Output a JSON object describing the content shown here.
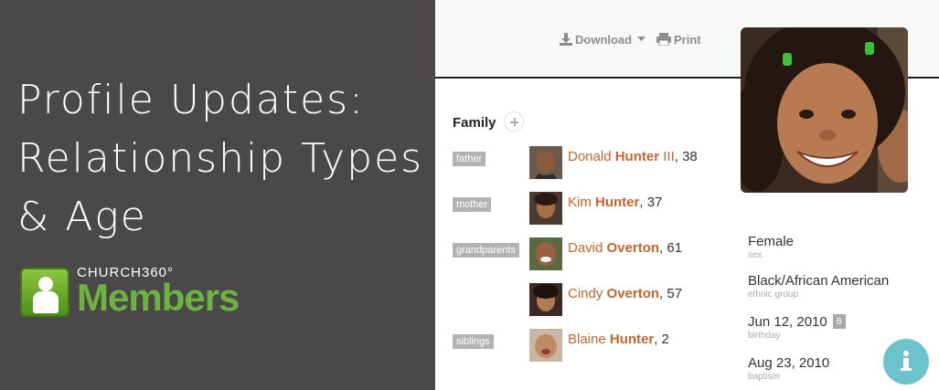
{
  "banner": {
    "headline_lines": [
      "Profile Updates:",
      "Relationship Types",
      "& Age"
    ],
    "logo_small": "CHURCH360°",
    "logo_big": "Members"
  },
  "toolbar": {
    "download_label": "Download",
    "print_label": "Print"
  },
  "family": {
    "title": "Family",
    "members": [
      {
        "relation": "father",
        "first": "Donald",
        "last": "Hunter",
        "suffix": " III",
        "age": ", 38"
      },
      {
        "relation": "mother",
        "first": "Kim",
        "last": "Hunter",
        "suffix": "",
        "age": ", 37"
      },
      {
        "relation": "grandparents",
        "first": "David",
        "last": "Overton",
        "suffix": "",
        "age": ", 61"
      },
      {
        "relation": "",
        "first": "Cindy",
        "last": "Overton",
        "suffix": "",
        "age": ", 57"
      },
      {
        "relation": "siblings",
        "first": "Blaine",
        "last": "Hunter",
        "suffix": "",
        "age": ", 2"
      }
    ]
  },
  "details": {
    "sex": {
      "value": "Female",
      "caption": "sex"
    },
    "ethnic_group": {
      "value": "Black/African American",
      "caption": "ethnic group"
    },
    "birthday": {
      "value": "Jun 12, 2010",
      "age_badge": "6",
      "caption": "birthday"
    },
    "baptism": {
      "value": "Aug 23, 2010",
      "caption": "baptism"
    }
  },
  "colors": {
    "banner_bg": "#4a4848",
    "name_link": "#c4662d",
    "brand_green": "#6cb33f",
    "info_button": "#6cc3cc"
  },
  "icons": [
    "download-icon",
    "caret-down-icon",
    "print-icon",
    "add-icon",
    "info-icon"
  ]
}
